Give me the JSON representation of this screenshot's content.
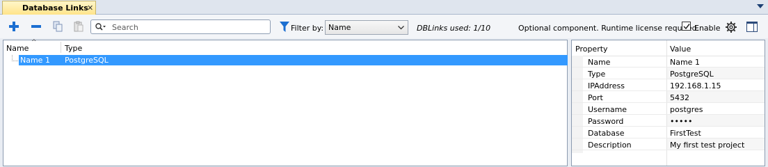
{
  "tab": {
    "title": "Database Links",
    "close_glyph": "✕"
  },
  "toolbar": {
    "search_placeholder": "Search",
    "filter_label": "Filter by:",
    "filter_value": "Name",
    "dblinks_used": "DBLinks used: 1/10",
    "optional_text": "Optional component. Runtime license required.",
    "enable_label": "Enable",
    "enable_checked": true,
    "icons": [
      "add-icon",
      "remove-icon",
      "copy-icon",
      "paste-icon",
      "search-icon",
      "filter-icon",
      "gear-icon",
      "panel-icon"
    ]
  },
  "list": {
    "columns": [
      "Name",
      "Type"
    ],
    "rows": [
      {
        "name": "Name 1",
        "type": "PostgreSQL"
      }
    ]
  },
  "properties": {
    "columns": [
      "Property",
      "Value"
    ],
    "rows": [
      {
        "name": "Name",
        "value": "Name 1"
      },
      {
        "name": "Type",
        "value": "PostgreSQL"
      },
      {
        "name": "IPAddress",
        "value": "192.168.1.15"
      },
      {
        "name": "Port",
        "value": "5432"
      },
      {
        "name": "Username",
        "value": "postgres"
      },
      {
        "name": "Password",
        "value": "•••••"
      },
      {
        "name": "Database",
        "value": "FirstTest"
      },
      {
        "name": "Description",
        "value": "My first test project"
      }
    ]
  },
  "colors": {
    "selection": "#3399ff",
    "accent": "#1c6fd1",
    "tab": "#ffe48a"
  }
}
